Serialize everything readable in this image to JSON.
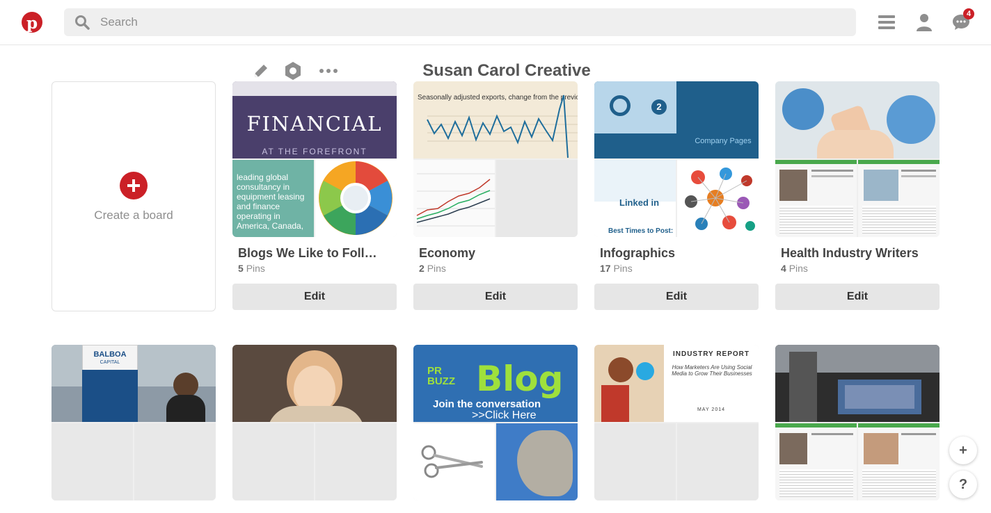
{
  "header": {
    "logo_letter": "p",
    "search_placeholder": "Search",
    "notification_count": "4",
    "icons": [
      "pinterest-logo",
      "search-icon",
      "menu-icon",
      "profile-icon",
      "messages-icon"
    ]
  },
  "toolbar": {
    "icons": [
      "pencil-icon",
      "gear-icon",
      "more-icon"
    ],
    "board_title": "Susan Carol Creative"
  },
  "create": {
    "label": "Create a board"
  },
  "boards": [
    {
      "name": "Blogs We Like to Foll…",
      "pin_count": "5",
      "pins_word": "Pins",
      "edit": "Edit",
      "big_text": "FINANCIAL",
      "big_sub": "AT THE FOREFRONT",
      "sm1_text": "leading global consultancy in equipment leasing and finance operating in America, Canada, ..."
    },
    {
      "name": "Economy",
      "pin_count": "2",
      "pins_word": "Pins",
      "edit": "Edit",
      "big_text": "Seasonally adjusted exports, change from the previous month"
    },
    {
      "name": "Infographics",
      "pin_count": "17",
      "pins_word": "Pins",
      "edit": "Edit",
      "big_text": "Company Pages",
      "sm1_text": "Linked in",
      "sm1_sub": "Best Times to Post:"
    },
    {
      "name": "Health Industry Writers",
      "pin_count": "4",
      "pins_word": "Pins",
      "edit": "Edit"
    },
    {
      "name": "",
      "big_text": "BALBOA",
      "big_sub": "CAPITAL"
    },
    {
      "name": ""
    },
    {
      "name": "",
      "big_text": "Blog",
      "big_sub": "PR BUZZ",
      "big_sub2": "Join the conversation",
      "big_sub3": ">>Click Here"
    },
    {
      "name": "",
      "big_text": "INDUSTRY REPORT",
      "big_sub": "How Marketers Are Using Social Media to Grow Their Businesses",
      "big_sub2": "MAY 2014"
    },
    {
      "name": ""
    }
  ],
  "fab": {
    "plus": "+",
    "help": "?"
  }
}
